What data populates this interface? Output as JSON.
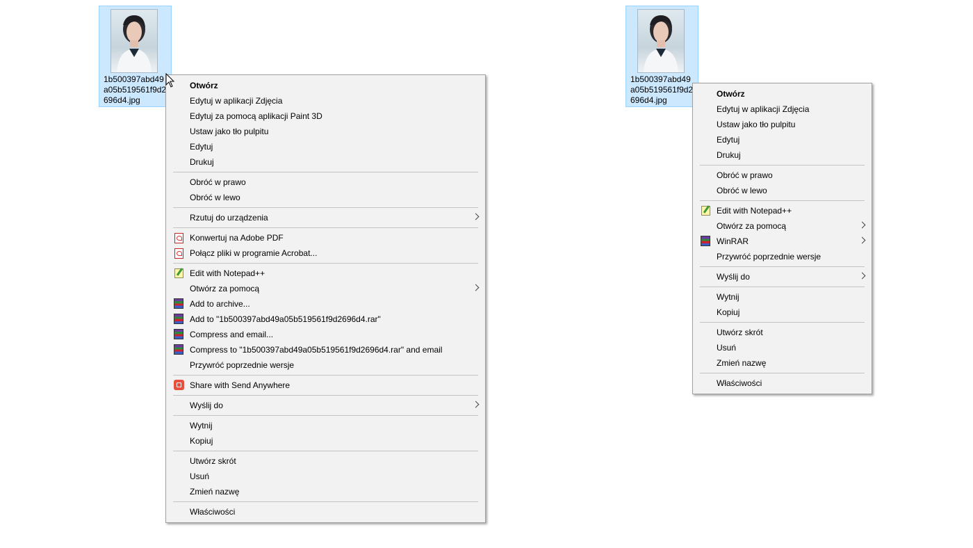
{
  "file_left": {
    "name": "1b500397abd49a05b519561f9d2696d4.jpg"
  },
  "file_right": {
    "name": "1b500397abd49a05b519561f9d2696d4.jpg"
  },
  "menu_left": {
    "groups": [
      [
        {
          "label": "Otwórz",
          "bold": true
        },
        {
          "label": "Edytuj w aplikacji Zdjęcia"
        },
        {
          "label": "Edytuj za pomocą aplikacji Paint 3D"
        },
        {
          "label": "Ustaw jako tło pulpitu"
        },
        {
          "label": "Edytuj"
        },
        {
          "label": "Drukuj"
        }
      ],
      [
        {
          "label": "Obróć w prawo"
        },
        {
          "label": "Obróć w lewo"
        }
      ],
      [
        {
          "label": "Rzutuj do urządzenia",
          "submenu": true
        }
      ],
      [
        {
          "label": "Konwertuj na Adobe PDF",
          "icon": "pdf-icon"
        },
        {
          "label": "Połącz pliki w programie Acrobat...",
          "icon": "pdf-icon"
        }
      ],
      [
        {
          "label": "Edit with Notepad++",
          "icon": "notepad-icon"
        },
        {
          "label": "Otwórz za pomocą",
          "submenu": true
        },
        {
          "label": "Add to archive...",
          "icon": "winrar-icon"
        },
        {
          "label": "Add to \"1b500397abd49a05b519561f9d2696d4.rar\"",
          "icon": "winrar-icon"
        },
        {
          "label": "Compress and email...",
          "icon": "winrar-icon"
        },
        {
          "label": "Compress to \"1b500397abd49a05b519561f9d2696d4.rar\" and email",
          "icon": "winrar-icon"
        },
        {
          "label": "Przywróć poprzednie wersje"
        }
      ],
      [
        {
          "label": "Share with Send Anywhere",
          "icon": "send-anywhere-icon"
        }
      ],
      [
        {
          "label": "Wyślij do",
          "submenu": true
        }
      ],
      [
        {
          "label": "Wytnij"
        },
        {
          "label": "Kopiuj"
        }
      ],
      [
        {
          "label": "Utwórz skrót"
        },
        {
          "label": "Usuń"
        },
        {
          "label": "Zmień nazwę"
        }
      ],
      [
        {
          "label": "Właściwości"
        }
      ]
    ]
  },
  "menu_right": {
    "groups": [
      [
        {
          "label": "Otwórz",
          "bold": true
        },
        {
          "label": "Edytuj w aplikacji Zdjęcia"
        },
        {
          "label": "Ustaw jako tło pulpitu"
        },
        {
          "label": "Edytuj"
        },
        {
          "label": "Drukuj"
        }
      ],
      [
        {
          "label": "Obróć w prawo"
        },
        {
          "label": "Obróć w lewo"
        }
      ],
      [
        {
          "label": "Edit with Notepad++",
          "icon": "notepad-icon"
        },
        {
          "label": "Otwórz za pomocą",
          "submenu": true
        },
        {
          "label": "WinRAR",
          "icon": "winrar-icon",
          "submenu": true
        },
        {
          "label": "Przywróć poprzednie wersje"
        }
      ],
      [
        {
          "label": "Wyślij do",
          "submenu": true
        }
      ],
      [
        {
          "label": "Wytnij"
        },
        {
          "label": "Kopiuj"
        }
      ],
      [
        {
          "label": "Utwórz skrót"
        },
        {
          "label": "Usuń"
        },
        {
          "label": "Zmień nazwę"
        }
      ],
      [
        {
          "label": "Właściwości"
        }
      ]
    ]
  }
}
